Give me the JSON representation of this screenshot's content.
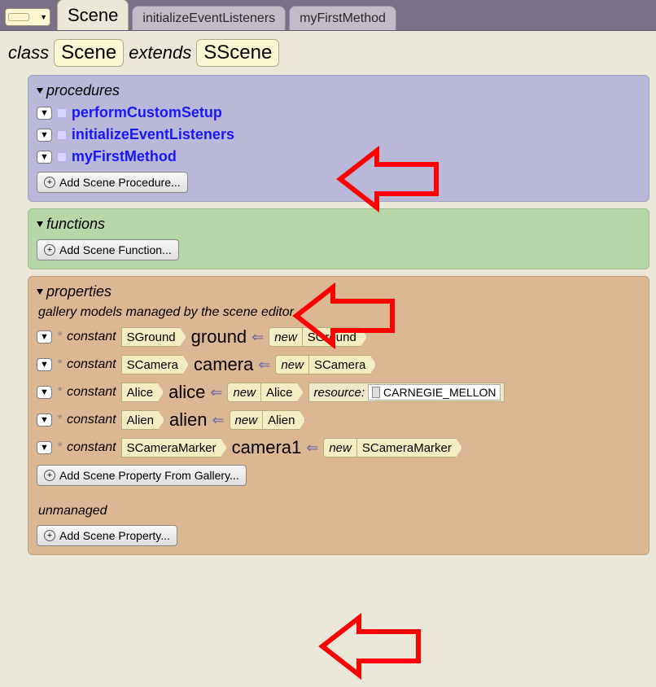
{
  "tabs": {
    "active": "Scene",
    "others": [
      "initializeEventListeners",
      "myFirstMethod"
    ]
  },
  "classHeader": {
    "class_kw": "class",
    "class_name": "Scene",
    "extends_kw": "extends",
    "super_name": "SScene"
  },
  "procedures": {
    "title": "procedures",
    "items": [
      {
        "name": "performCustomSetup"
      },
      {
        "name": "initializeEventListeners"
      },
      {
        "name": "myFirstMethod"
      }
    ],
    "add_label": "Add Scene Procedure..."
  },
  "functions": {
    "title": "functions",
    "add_label": "Add Scene Function..."
  },
  "properties": {
    "title": "properties",
    "subhead_managed": "gallery models managed by the scene editor",
    "items": [
      {
        "type": "SGround",
        "name": "ground",
        "ctor": "SGround",
        "resource": null
      },
      {
        "type": "SCamera",
        "name": "camera",
        "ctor": "SCamera",
        "resource": null
      },
      {
        "type": "Alice",
        "name": "alice",
        "ctor": "Alice",
        "resource": "CARNEGIE_MELLON"
      },
      {
        "type": "Alien",
        "name": "alien",
        "ctor": "Alien",
        "resource": null
      },
      {
        "type": "SCameraMarker",
        "name": "camera1",
        "ctor": "SCameraMarker",
        "resource": null
      }
    ],
    "kw_constant": "constant",
    "kw_new": "new",
    "kw_resource": "resource:",
    "add_from_gallery": "Add Scene Property From Gallery...",
    "subhead_unmanaged": "unmanaged",
    "add_prop": "Add Scene Property..."
  }
}
